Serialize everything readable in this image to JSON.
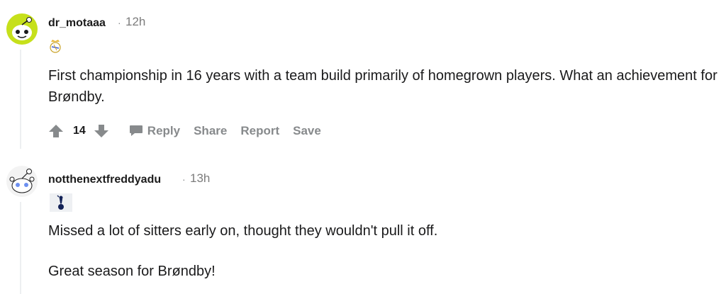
{
  "comments": [
    {
      "username": "dr_motaaa",
      "separator": "·",
      "time": "12h",
      "flair_icon": "real-madrid-crest-icon",
      "body": [
        "First championship in 16 years with a team build primarily of homegrown players. What an achievement for Brøndby."
      ],
      "votes": "14",
      "actions": {
        "reply": "Reply",
        "share": "Share",
        "report": "Report",
        "save": "Save"
      },
      "avatar_color": "#c6e01b"
    },
    {
      "username": "notthenextfreddyadu",
      "separator": "·",
      "time": "13h",
      "flair_icon": "tottenham-cockerel-icon",
      "body": [
        "Missed a lot of sitters early on, thought they wouldn't pull it off.",
        "Great season for Brøndby!"
      ],
      "avatar_color": "#f3f3f3"
    }
  ],
  "colors": {
    "meta_gray": "#878a8c",
    "thread_line": "#edeff1",
    "text": "#1a1a1b"
  }
}
